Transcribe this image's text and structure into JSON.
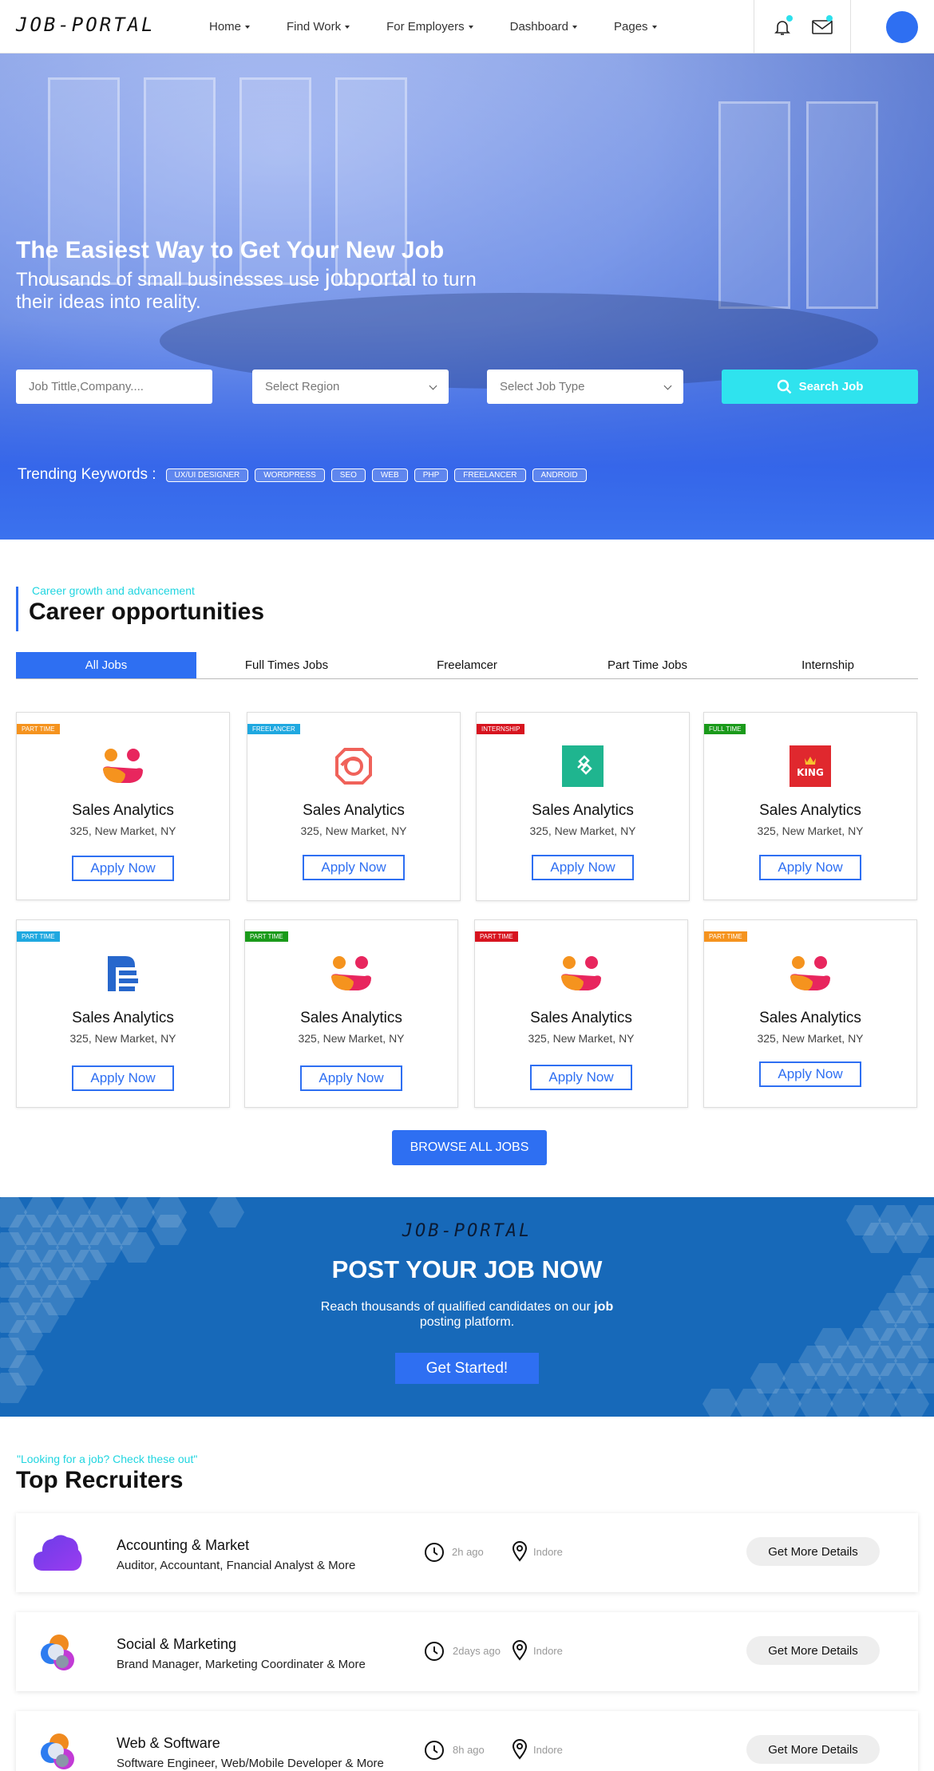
{
  "brand": {
    "logo": "JOB-PORTAL"
  },
  "nav": {
    "items": [
      {
        "label": "Home"
      },
      {
        "label": "Find Work"
      },
      {
        "label": "For Employers"
      },
      {
        "label": "Dashboard"
      },
      {
        "label": "Pages"
      }
    ]
  },
  "hero": {
    "title": "The Easiest Way to Get Your New Job",
    "subtitle_start": "Thousands of small businesses use ",
    "subtitle_brand": "jobportal",
    "subtitle_end": " to turn their ideas into reality.",
    "search": {
      "keyword_placeholder": "Job  Tittle,Company....",
      "region_placeholder": "Select Region",
      "jobtype_placeholder": "Select Job Type",
      "button_label": "Search Job"
    },
    "trending_label": "Trending Keywords :",
    "trending_tags": [
      "UX/UI DESIGNER",
      "WORDPRESS",
      "SEO",
      "WEB",
      "PHP",
      "FREELANCER",
      "ANDROID"
    ]
  },
  "career": {
    "eyebrow": "Career growth and advancement",
    "title": "Career opportunities",
    "tabs": [
      {
        "label": "All Jobs",
        "active": true
      },
      {
        "label": "Full Times Jobs"
      },
      {
        "label": "Freelamcer"
      },
      {
        "label": "Part Time Jobs"
      },
      {
        "label": "Internship"
      }
    ],
    "jobs": [
      {
        "badge": "PART TIME",
        "badge_color": "#f5931e",
        "logo": "smile-logo",
        "title": "Sales Analytics",
        "location": "325, New Market, NY",
        "apply_label": "Apply Now"
      },
      {
        "badge": "FREELANCER",
        "badge_color": "#1fa8e0",
        "logo": "camera-logo",
        "title": "Sales Analytics",
        "location": "325, New Market, NY",
        "apply_label": "Apply Now"
      },
      {
        "badge": "INTERNSHIP",
        "badge_color": "#d7141f",
        "logo": "teal-square-logo",
        "title": "Sales Analytics",
        "location": "325, New Market, NY",
        "apply_label": "Apply Now"
      },
      {
        "badge": "FULL TIME",
        "badge_color": "#1a9a1a",
        "logo": "king-logo",
        "logo_text": "KING",
        "title": "Sales Analytics",
        "location": "325, New Market, NY",
        "apply_label": "Apply Now"
      },
      {
        "badge": "PART TIME",
        "badge_color": "#1fa8e0",
        "logo": "document-logo",
        "title": "Sales Analytics",
        "location": "325, New Market, NY",
        "apply_label": "Apply Now"
      },
      {
        "badge": "PART TIME",
        "badge_color": "#1a9a1a",
        "logo": "smile-logo",
        "title": "Sales Analytics",
        "location": "325, New Market, NY",
        "apply_label": "Apply Now"
      },
      {
        "badge": "PART TIME",
        "badge_color": "#d7141f",
        "logo": "smile-logo",
        "title": "Sales Analytics",
        "location": "325, New Market, NY",
        "apply_label": "Apply Now"
      },
      {
        "badge": "PART TIME",
        "badge_color": "#f5931e",
        "logo": "smile-logo",
        "title": "Sales Analytics",
        "location": "325, New Market, NY",
        "apply_label": "Apply Now"
      }
    ],
    "browse_label": "BROWSE ALL JOBS"
  },
  "post_job": {
    "logo": "JOB-PORTAL",
    "title": "POST YOUR JOB NOW",
    "subtitle_start": "Reach thousands of qualified candidates on our ",
    "subtitle_bold": "job",
    "subtitle_end": " posting platform.",
    "button_label": "Get Started!"
  },
  "recruiters": {
    "eyebrow": "\"Looking for a job? Check these out\"",
    "title": "Top Recruiters",
    "items": [
      {
        "name": "Accounting & Market",
        "roles": "Auditor, Accountant, Fnancial Analyst & More",
        "time": "2h ago",
        "location": "Indore",
        "button_label": "Get More Details",
        "logo": "cloud-logo"
      },
      {
        "name": "Social & Marketing",
        "roles": "Brand Manager, Marketing Coordinater & More",
        "time": "2days ago",
        "location": "Indore",
        "button_label": "Get More Details",
        "logo": "swirl-logo"
      },
      {
        "name": "Web & Software",
        "roles": "Software Engineer, Web/Mobile Developer & More",
        "time": "8h ago",
        "location": "Indore",
        "button_label": "Get More Details",
        "logo": "swirl-logo"
      }
    ]
  },
  "colors": {
    "primary": "#2e6ff2",
    "accent_cyan": "#2fe3ee",
    "banner_blue": "#1769b9"
  }
}
